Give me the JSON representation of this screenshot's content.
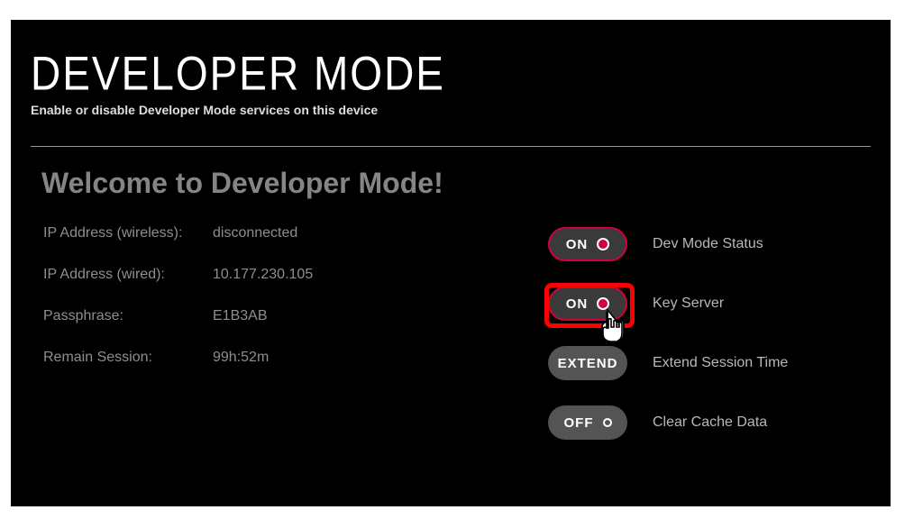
{
  "header": {
    "title": "DEVELOPER MODE",
    "subtitle": "Enable or disable Developer Mode services on this device"
  },
  "welcome": "Welcome to Developer Mode!",
  "info": {
    "wireless_label": "IP Address (wireless):",
    "wireless_value": "disconnected",
    "wired_label": "IP Address (wired):",
    "wired_value": "10.177.230.105",
    "passphrase_label": "Passphrase:",
    "passphrase_value": "E1B3AB",
    "remain_label": "Remain Session:",
    "remain_value": "99h:52m"
  },
  "controls": {
    "dev_mode": {
      "state": "ON",
      "label": "Dev Mode Status"
    },
    "key_server": {
      "state": "ON",
      "label": "Key Server"
    },
    "extend": {
      "state": "EXTEND",
      "label": "Extend Session Time"
    },
    "clear_cache": {
      "state": "OFF",
      "label": "Clear Cache Data"
    }
  }
}
